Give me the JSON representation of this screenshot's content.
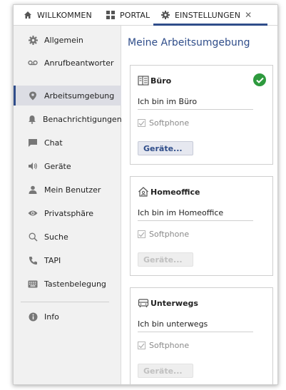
{
  "tabs": [
    {
      "label": "WILLKOMMEN",
      "icon": "home-icon"
    },
    {
      "label": "PORTAL",
      "icon": "grid-icon"
    },
    {
      "label": "EINSTELLUNGEN",
      "icon": "gear-icon",
      "active": true,
      "closable": true
    }
  ],
  "sidebar": {
    "items": [
      {
        "label": "Allgemein",
        "icon": "gear-icon"
      },
      {
        "label": "Anrufbeantworter",
        "icon": "voicemail-icon"
      },
      {
        "label": "Arbeitsumgebung",
        "icon": "location-pin-icon",
        "active": true
      },
      {
        "label": "Benachrichtigungen",
        "icon": "bell-icon"
      },
      {
        "label": "Chat",
        "icon": "chat-icon"
      },
      {
        "label": "Geräte",
        "icon": "speaker-icon"
      },
      {
        "label": "Mein Benutzer",
        "icon": "user-icon"
      },
      {
        "label": "Privatsphäre",
        "icon": "eye-icon"
      },
      {
        "label": "Suche",
        "icon": "search-icon"
      },
      {
        "label": "TAPI",
        "icon": "phone-icon"
      },
      {
        "label": "Tastenbelegung",
        "icon": "keyboard-icon"
      },
      {
        "label": "Info",
        "icon": "info-icon"
      }
    ]
  },
  "main": {
    "title": "Meine Arbeitsumgebung",
    "cards": [
      {
        "title": "Büro",
        "icon": "office-icon",
        "name_value": "Ich bin im Büro",
        "softphone_label": "Softphone",
        "softphone_checked": true,
        "devices_button": "Geräte...",
        "active": true,
        "button_enabled": true
      },
      {
        "title": "Homeoffice",
        "icon": "home-office-icon",
        "name_value": "Ich bin im Homeoffice",
        "softphone_label": "Softphone",
        "softphone_checked": true,
        "devices_button": "Geräte...",
        "active": false,
        "button_enabled": false
      },
      {
        "title": "Unterwegs",
        "icon": "car-icon",
        "name_value": "Ich bin unterwegs",
        "softphone_label": "Softphone",
        "softphone_checked": true,
        "devices_button": "Geräte...",
        "active": false,
        "button_enabled": false
      }
    ]
  },
  "colors": {
    "accent": "#2f4d8a",
    "success": "#2e9a3e",
    "sidebar_bg": "#f1f1f1",
    "active_bg": "#dcdde4"
  }
}
